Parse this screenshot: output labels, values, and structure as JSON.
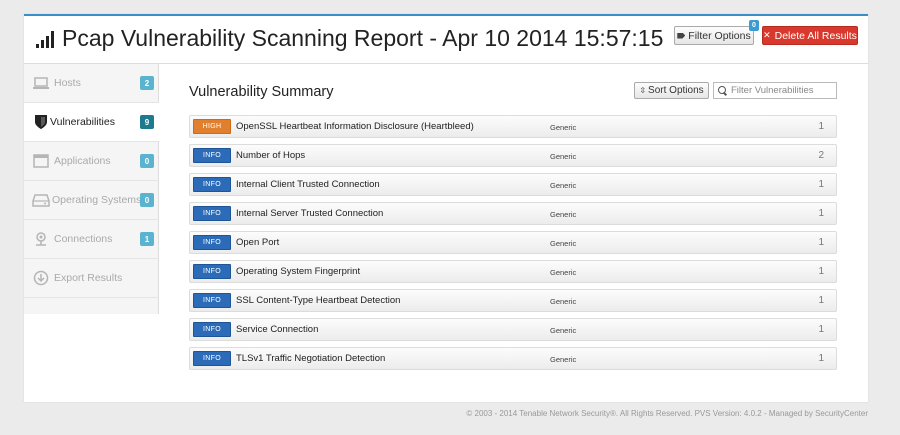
{
  "header": {
    "title": "Pcap Vulnerability Scanning Report - Apr 10 2014 15:57:15",
    "filter_label": "Filter Options",
    "filter_count": "0",
    "delete_label": "Delete All Results"
  },
  "sidebar": {
    "items": [
      {
        "label": "Hosts",
        "badge": "2",
        "icon": "laptop-icon"
      },
      {
        "label": "Vulnerabilities",
        "badge": "9",
        "icon": "shield-icon"
      },
      {
        "label": "Applications",
        "badge": "0",
        "icon": "window-icon"
      },
      {
        "label": "Operating Systems",
        "badge": "0",
        "icon": "hard-drive-icon"
      },
      {
        "label": "Connections",
        "badge": "1",
        "icon": "connections-icon"
      },
      {
        "label": "Export Results",
        "icon": "download-icon"
      }
    ]
  },
  "main": {
    "section_title": "Vulnerability Summary",
    "sort_label": "Sort Options",
    "search_placeholder": "Filter Vulnerabilities",
    "vulnerabilities": [
      {
        "severity": "HIGH",
        "name": "OpenSSL Heartbeat Information Disclosure (Heartbleed)",
        "family": "Generic",
        "count": "1"
      },
      {
        "severity": "INFO",
        "name": "Number of Hops",
        "family": "Generic",
        "count": "2"
      },
      {
        "severity": "INFO",
        "name": "Internal Client Trusted Connection",
        "family": "Generic",
        "count": "1"
      },
      {
        "severity": "INFO",
        "name": "Internal Server Trusted Connection",
        "family": "Generic",
        "count": "1"
      },
      {
        "severity": "INFO",
        "name": "Open Port",
        "family": "Generic",
        "count": "1"
      },
      {
        "severity": "INFO",
        "name": "Operating System Fingerprint",
        "family": "Generic",
        "count": "1"
      },
      {
        "severity": "INFO",
        "name": "SSL Content-Type Heartbeat Detection",
        "family": "Generic",
        "count": "1"
      },
      {
        "severity": "INFO",
        "name": "Service Connection",
        "family": "Generic",
        "count": "1"
      },
      {
        "severity": "INFO",
        "name": "TLSv1 Traffic Negotiation Detection",
        "family": "Generic",
        "count": "1"
      }
    ]
  },
  "footer": {
    "text": "© 2003 - 2014 Tenable Network Security®. All Rights Reserved. PVS Version: 4.0.2 - Managed by SecurityCenter"
  },
  "colors": {
    "accent": "#3a8fc8",
    "danger": "#d9392c",
    "severity_high": "#e0802f",
    "severity_info": "#2b6bb8",
    "badge": "#5ab3cf",
    "badge_active": "#1e7a8e"
  }
}
